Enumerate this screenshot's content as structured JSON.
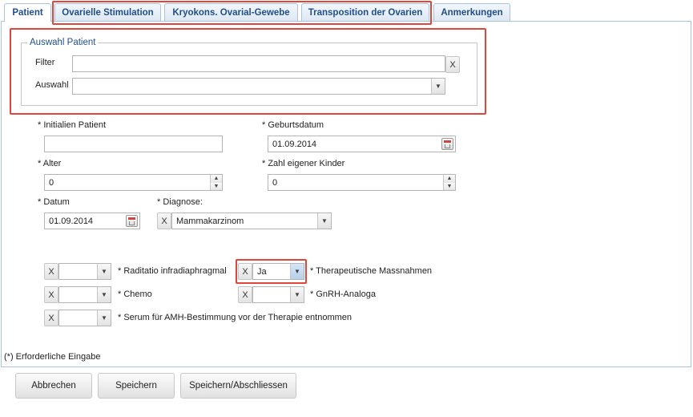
{
  "tabs": [
    {
      "label": "Patient"
    },
    {
      "label": "Ovarielle Stimulation"
    },
    {
      "label": "Kryokons. Ovarial-Gewebe"
    },
    {
      "label": "Transposition der Ovarien"
    },
    {
      "label": "Anmerkungen"
    }
  ],
  "auswahl": {
    "legend": "Auswahl Patient",
    "filter_label": "Filter",
    "filter_value": "",
    "clear_label": "X",
    "auswahl_label": "Auswahl",
    "auswahl_value": ""
  },
  "fields": {
    "initialen_label": "* Initialien Patient",
    "initialen_value": "",
    "geburtsdatum_label": "* Geburtsdatum",
    "geburtsdatum_value": "01.09.2014",
    "alter_label": "* Alter",
    "alter_value": "0",
    "kinder_label": "* Zahl eigener Kinder",
    "kinder_value": "0",
    "datum_label": "* Datum",
    "datum_value": "01.09.2014",
    "diagnose_label": "* Diagnose:",
    "diagnose_value": "Mammakarzinom"
  },
  "checks": {
    "radiatio_label": "* Raditatio infradiaphragmal",
    "radiatio_value": "",
    "therapeutische_label": "* Therapeutische Massnahmen",
    "therapeutische_value": "Ja",
    "chemo_label": "* Chemo",
    "chemo_value": "",
    "gnrh_label": "* GnRH-Analoga",
    "gnrh_value": "",
    "serum_label": "* Serum für AMH-Bestimmung vor der Therapie entnommen",
    "serum_value": ""
  },
  "clear_x": "X",
  "required_note": "(*) Erforderliche Eingabe",
  "buttons": {
    "cancel": "Abbrechen",
    "save": "Speichern",
    "save_close": "Speichern/Abschliessen"
  }
}
